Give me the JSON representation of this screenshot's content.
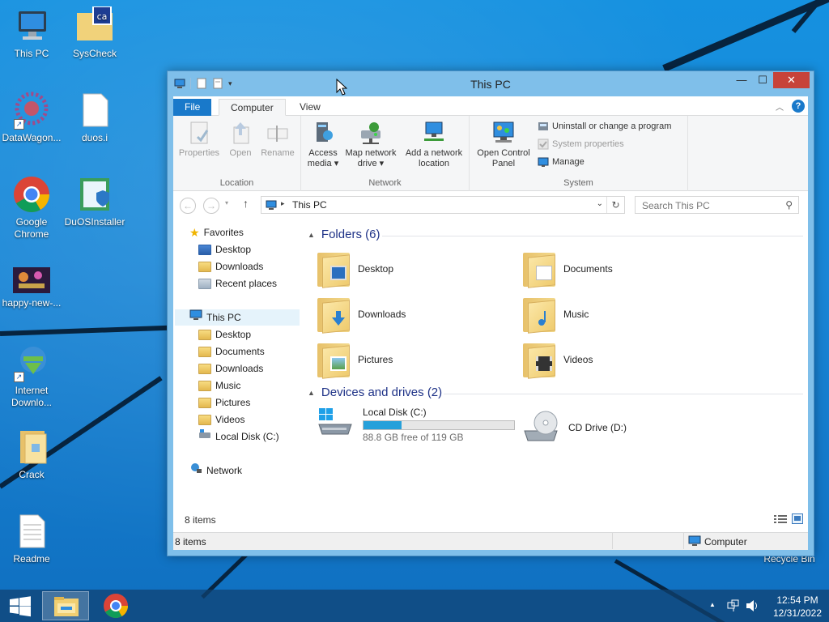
{
  "desktop": {
    "icons": [
      {
        "label": "This PC"
      },
      {
        "label": "SysCheck"
      },
      {
        "label": "DataWagon..."
      },
      {
        "label": "duos.i"
      },
      {
        "label": "Google Chrome"
      },
      {
        "label": "DuOSInstaller"
      },
      {
        "label": "happy-new-..."
      },
      {
        "label": "Internet Downlo..."
      },
      {
        "label": "Crack"
      },
      {
        "label": "Readme"
      },
      {
        "label": "Recycle Bin"
      }
    ]
  },
  "window": {
    "title": "This PC",
    "controls": {
      "minimize": "—",
      "maximize": "☐",
      "close": "✕"
    },
    "tabs": {
      "file": "File",
      "computer": "Computer",
      "view": "View"
    },
    "ribbon": {
      "location": {
        "label": "Location",
        "properties": "Properties",
        "open": "Open",
        "rename": "Rename"
      },
      "network": {
        "label": "Network",
        "access_media": "Access media",
        "map_drive": "Map network drive",
        "add_location": "Add a network location"
      },
      "system": {
        "label": "System",
        "control_panel": "Open Control Panel",
        "uninstall": "Uninstall or change a program",
        "system_properties": "System properties",
        "manage": "Manage"
      }
    },
    "address": {
      "path": "This PC",
      "search_placeholder": "Search This PC"
    },
    "nav": {
      "favorites": "Favorites",
      "fav_items": [
        "Desktop",
        "Downloads",
        "Recent places"
      ],
      "this_pc": "This PC",
      "pc_items": [
        "Desktop",
        "Documents",
        "Downloads",
        "Music",
        "Pictures",
        "Videos",
        "Local Disk (C:)"
      ],
      "network": "Network"
    },
    "content": {
      "folders_header": "Folders (6)",
      "folders": [
        "Desktop",
        "Documents",
        "Downloads",
        "Music",
        "Pictures",
        "Videos"
      ],
      "devices_header": "Devices and drives (2)",
      "drives": [
        {
          "name": "Local Disk (C:)",
          "free_text": "88.8 GB free of 119 GB",
          "used_fraction": 0.254
        },
        {
          "name": "CD Drive (D:)"
        }
      ]
    },
    "status_items": "8 items",
    "status_bar_items": "8 items",
    "status_location": "Computer"
  },
  "taskbar": {
    "time": "12:54 PM",
    "date": "12/31/2022"
  }
}
